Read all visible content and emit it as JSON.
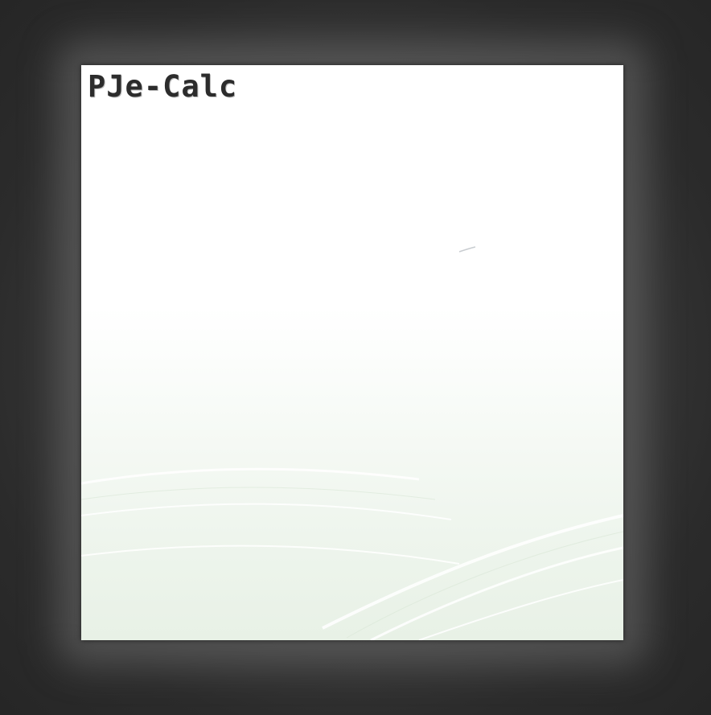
{
  "splash": {
    "app_title": "PJe-Calc"
  },
  "colors": {
    "background": "#2b2b2b",
    "panel": "#ffffff",
    "panel_bottom_tint": "#e8f1e6",
    "title_text": "#2c2c2c"
  }
}
